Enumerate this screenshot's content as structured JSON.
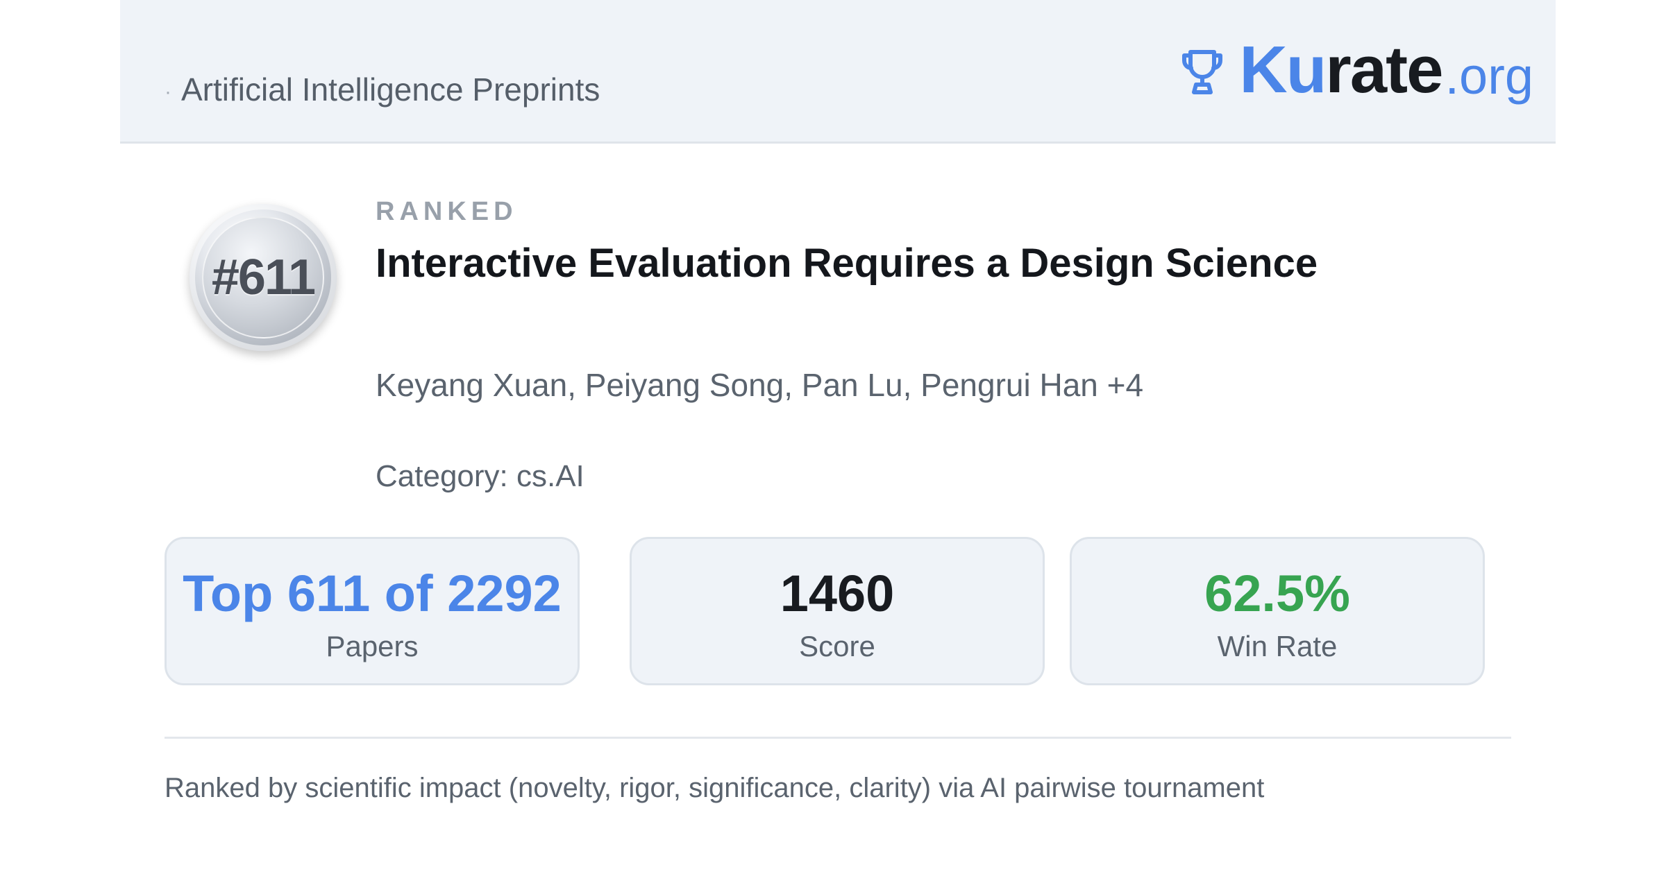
{
  "header": {
    "breadcrumb_separator": "·",
    "breadcrumb": "Artificial Intelligence Preprints",
    "logo": {
      "icon": "trophy-icon",
      "part_ku": "Ku",
      "part_rate": "rate",
      "part_org": ".org"
    }
  },
  "paper": {
    "rank_badge": "#611",
    "ranked_label": "RANKED",
    "title": "Interactive Evaluation Requires a Design Science",
    "authors": "Keyang Xuan, Peiyang Song, Pan Lu, Pengrui Han +4",
    "category": "Category: cs.AI"
  },
  "stats": [
    {
      "value": "Top 611 of 2292",
      "label": "Papers"
    },
    {
      "value": "1460",
      "label": "Score"
    },
    {
      "value": "62.5%",
      "label": "Win Rate"
    }
  ],
  "footer": {
    "note": "Ranked by scientific impact (novelty, rigor, significance, clarity) via AI pairwise tournament"
  },
  "colors": {
    "accent_blue": "#4b85e8",
    "win_green": "#37a451",
    "header_bg": "#eff3f8",
    "text_dark": "#14171c",
    "text_muted": "#5a636e"
  }
}
